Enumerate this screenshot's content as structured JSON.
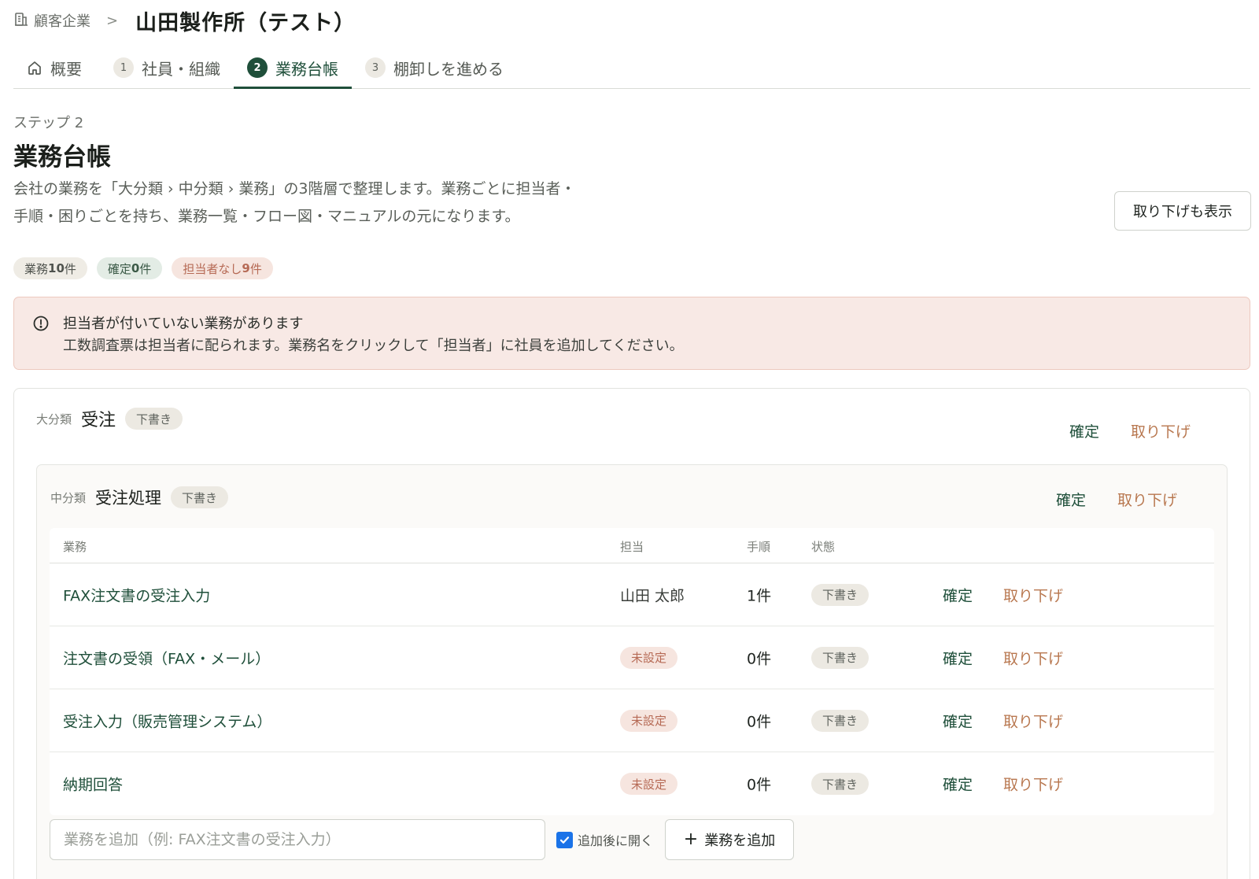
{
  "breadcrumb": {
    "parent_label": "顧客企業",
    "parent_icon": "building-icon",
    "separator": ">",
    "current_title": "山田製作所（テスト）"
  },
  "tabs": [
    {
      "num": "",
      "label": "概要",
      "icon": "home-icon",
      "active": false
    },
    {
      "num": "1",
      "label": "社員・組織",
      "active": false
    },
    {
      "num": "2",
      "label": "業務台帳",
      "active": true
    },
    {
      "num": "3",
      "label": "棚卸しを進める",
      "active": false
    }
  ],
  "header": {
    "step_label": "ステップ 2",
    "title": "業務台帳",
    "description_line1": "会社の業務を「大分類 › 中分類 › 業務」の3階層で整理します。業務ごとに担当者・",
    "description_line2": "手順・困りごとを持ち、業務一覧・フロー図・マニュアルの元になります。",
    "show_removed_label": "取り下げも表示"
  },
  "stats": {
    "tasks_prefix": "業務 ",
    "tasks_count": "10",
    "tasks_suffix": "件",
    "confirmed_prefix": "確定 ",
    "confirmed_count": "0",
    "confirmed_suffix": "件",
    "unassigned_prefix": "担当者なし ",
    "unassigned_count": "9",
    "unassigned_suffix": "件"
  },
  "alert": {
    "icon": "info-circle-icon",
    "title": "担当者が付いていない業務があります",
    "message": "工数調査票は担当者に配られます。業務名をクリックして「担当者」に社員を追加してください。"
  },
  "category": {
    "prefix": "大分類",
    "name": "受注",
    "status": "下書き",
    "confirm_label": "確定",
    "remove_label": "取り下げ"
  },
  "subcategory": {
    "prefix": "中分類",
    "name": "受注処理",
    "status": "下書き",
    "confirm_label": "確定",
    "remove_label": "取り下げ"
  },
  "table": {
    "headers": {
      "task": "業務",
      "assignee": "担当",
      "steps": "手順",
      "status": "状態"
    },
    "rows": [
      {
        "name": "FAX注文書の受注入力",
        "assignee": "山田 太郎",
        "assignee_unset": false,
        "steps": "1件",
        "status": "下書き",
        "confirm": "確定",
        "remove": "取り下げ"
      },
      {
        "name": "注文書の受領（FAX・メール）",
        "assignee": "未設定",
        "assignee_unset": true,
        "steps": "0件",
        "status": "下書き",
        "confirm": "確定",
        "remove": "取り下げ"
      },
      {
        "name": "受注入力（販売管理システム）",
        "assignee": "未設定",
        "assignee_unset": true,
        "steps": "0件",
        "status": "下書き",
        "confirm": "確定",
        "remove": "取り下げ"
      },
      {
        "name": "納期回答",
        "assignee": "未設定",
        "assignee_unset": true,
        "steps": "0件",
        "status": "下書き",
        "confirm": "確定",
        "remove": "取り下げ"
      }
    ]
  },
  "add_task": {
    "placeholder": "業務を追加（例: FAX注文書の受注入力）",
    "value": "",
    "open_after_add_label": "追加後に開く",
    "open_after_add_checked": true,
    "button_label": "業務を追加"
  },
  "colors": {
    "accent": "#1f4f3a",
    "remove_action": "#b8774f",
    "unset_badge_bg": "#f6e5df",
    "alert_bg": "#f8e9e5",
    "checkbox": "#1a73e8"
  }
}
